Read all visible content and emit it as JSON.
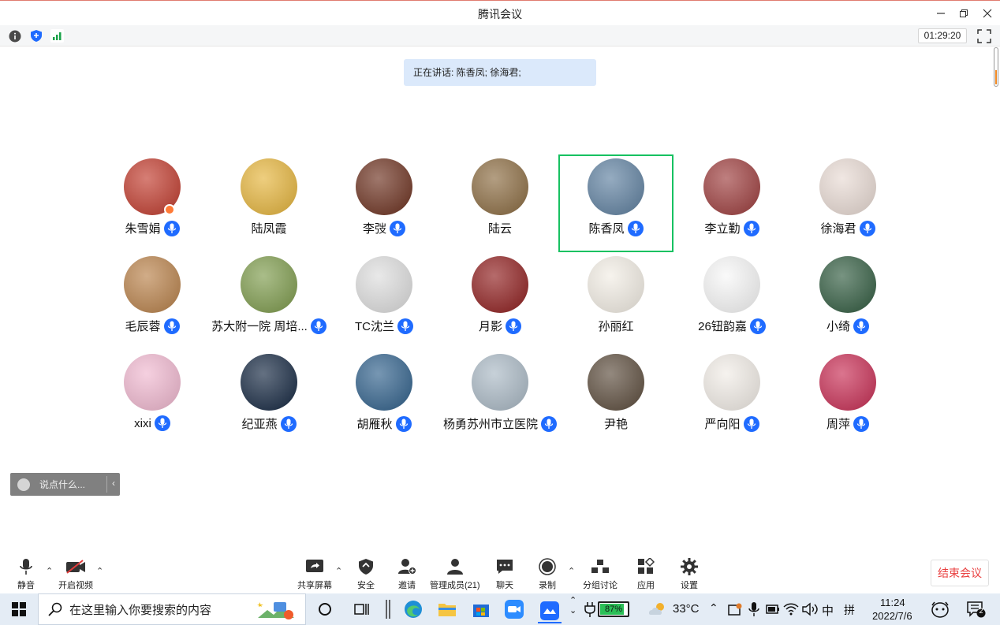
{
  "window": {
    "title": "腾讯会议",
    "timer": "01:29:20"
  },
  "speaking_banner": "正在讲话: 陈香凤; 徐海君;",
  "participants": [
    {
      "name": "朱雪娟",
      "mic": true,
      "host": true,
      "avatar_color": "#c0392b"
    },
    {
      "name": "陆凤霞",
      "mic": false,
      "host": false,
      "avatar_color": "#e5b43a"
    },
    {
      "name": "李弢",
      "mic": true,
      "host": false,
      "avatar_color": "#6b2f1d"
    },
    {
      "name": "陆云",
      "mic": false,
      "host": false,
      "avatar_color": "#8a6a3f"
    },
    {
      "name": "陈香凤",
      "mic": true,
      "host": false,
      "active": true,
      "avatar_color": "#5d7f9f"
    },
    {
      "name": "李立勤",
      "mic": true,
      "host": false,
      "avatar_color": "#9c3b3b"
    },
    {
      "name": "徐海君",
      "mic": true,
      "host": false,
      "avatar_color": "#e8dad3"
    },
    {
      "name": "毛辰蓉",
      "mic": true,
      "host": false,
      "avatar_color": "#b88048"
    },
    {
      "name": "苏大附一院 周培...",
      "mic": true,
      "host": false,
      "avatar_color": "#7c9a4a"
    },
    {
      "name": "TC沈兰",
      "mic": true,
      "host": false,
      "avatar_color": "#dddddd"
    },
    {
      "name": "月影",
      "mic": true,
      "host": false,
      "avatar_color": "#8e1c1c"
    },
    {
      "name": "孙丽红",
      "mic": false,
      "host": false,
      "avatar_color": "#f2ede4"
    },
    {
      "name": "26钮韵嘉",
      "mic": true,
      "host": false,
      "avatar_color": "#f7f7f7"
    },
    {
      "name": "小绮",
      "mic": true,
      "host": false,
      "avatar_color": "#2f5a3e"
    },
    {
      "name": "xixi",
      "mic": true,
      "host": false,
      "avatar_color": "#f0b7cf"
    },
    {
      "name": "纪亚燕",
      "mic": true,
      "host": false,
      "avatar_color": "#12253f"
    },
    {
      "name": "胡雁秋",
      "mic": true,
      "host": false,
      "avatar_color": "#2e5f8a"
    },
    {
      "name": "杨勇苏州市立医院",
      "mic": true,
      "host": false,
      "avatar_color": "#a9b8c4"
    },
    {
      "name": "尹艳",
      "mic": false,
      "host": false,
      "avatar_color": "#5a4a3a"
    },
    {
      "name": "严向阳",
      "mic": true,
      "host": false,
      "avatar_color": "#f1ece6"
    },
    {
      "name": "周萍",
      "mic": true,
      "host": false,
      "avatar_color": "#c72b52"
    }
  ],
  "chat": {
    "placeholder": "说点什么..."
  },
  "toolbar": {
    "mute": "静音",
    "video": "开启视频",
    "share": "共享屏幕",
    "security": "安全",
    "invite": "邀请",
    "members": "管理成员(21)",
    "chat": "聊天",
    "record": "录制",
    "breakout": "分组讨论",
    "apps": "应用",
    "settings": "设置",
    "end": "结束会议"
  },
  "taskbar": {
    "search_placeholder": "在这里输入你要搜索的内容",
    "battery": "87%",
    "weather": "33°C",
    "ime_lang": "中",
    "ime_mode": "拼",
    "time": "11:24",
    "date": "2022/7/6",
    "notifications": "2"
  },
  "colors": {
    "accent_blue": "#1f6bff",
    "active_border": "#17c161",
    "end_red": "#e93f3f",
    "banner_bg": "#dbe9fb"
  }
}
